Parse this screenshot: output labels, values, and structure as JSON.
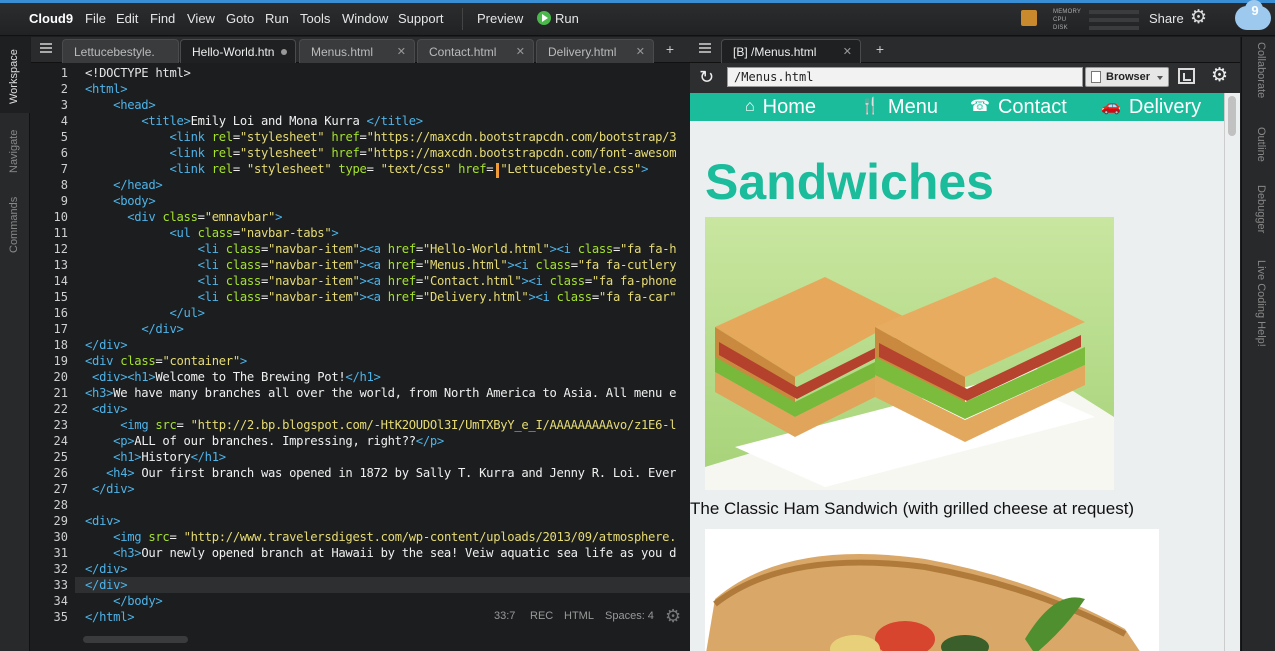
{
  "menubar": {
    "brand": "Cloud9",
    "items": [
      "File",
      "Edit",
      "Find",
      "View",
      "Goto",
      "Run",
      "Tools",
      "Window",
      "Support"
    ],
    "preview": "Preview",
    "run": "Run",
    "meters": [
      "MEMORY",
      "CPU",
      "DISK"
    ],
    "share": "Share"
  },
  "left_rail": [
    "Workspace",
    "Navigate",
    "Commands"
  ],
  "right_rail": [
    "Collaborate",
    "Outline",
    "Debugger",
    "Live Coding Help!"
  ],
  "editor_tabs": [
    {
      "label": "Lettucebestyle.",
      "active": false
    },
    {
      "label": "Hello-World.htn",
      "active": true
    },
    {
      "label": "Menus.html",
      "active": false
    },
    {
      "label": "Contact.html",
      "active": false
    },
    {
      "label": "Delivery.html",
      "active": false
    }
  ],
  "code_lines": [
    {
      "n": "1",
      "h": "<span class='p'>&lt;!DOCTYPE html&gt;</span>"
    },
    {
      "n": "2",
      "h": "<span class='t'>&lt;html&gt;</span>"
    },
    {
      "n": "3",
      "h": "    <span class='t'>&lt;head&gt;</span>"
    },
    {
      "n": "4",
      "h": "        <span class='t'>&lt;title&gt;</span>Emily Loi and Mona Kurra <span class='t'>&lt;/title&gt;</span>"
    },
    {
      "n": "5",
      "h": "            <span class='t'>&lt;link</span> <span class='a'>rel</span>=<span class='s'>\"stylesheet\"</span> <span class='a'>href</span>=<span class='s'>\"https://maxcdn.bootstrapcdn.com/bootstrap/3</span>"
    },
    {
      "n": "6",
      "h": "            <span class='t'>&lt;link</span> <span class='a'>rel</span>=<span class='s'>\"stylesheet\"</span> <span class='a'>href</span>=<span class='s'>\"https://maxcdn.bootstrapcdn.com/font-awesom</span>"
    },
    {
      "n": "7",
      "h": "            <span class='t'>&lt;link</span> <span class='a'>rel</span>= <span class='s'>\"stylesheet\"</span> <span class='a'>type</span>= <span class='s'>\"text/css\"</span> <span class='a'>href</span>= <span class='s'>\"Lettucebestyle.css\"</span><span class='t'>&gt;</span>"
    },
    {
      "n": "8",
      "h": "    <span class='t'>&lt;/head&gt;</span>"
    },
    {
      "n": "9",
      "h": "    <span class='t'>&lt;body&gt;</span>"
    },
    {
      "n": "10",
      "h": "      <span class='t'>&lt;div</span> <span class='a'>class</span>=<span class='s'>\"emnavbar\"</span><span class='t'>&gt;</span>"
    },
    {
      "n": "11",
      "h": "            <span class='t'>&lt;ul</span> <span class='a'>class</span>=<span class='s'>\"navbar-tabs\"</span><span class='t'>&gt;</span>"
    },
    {
      "n": "12",
      "h": "                <span class='t'>&lt;li</span> <span class='a'>class</span>=<span class='s'>\"navbar-item\"</span><span class='t'>&gt;&lt;a</span> <span class='a'>href</span>=<span class='s'>\"Hello-World.html\"</span><span class='t'>&gt;&lt;i</span> <span class='a'>class</span>=<span class='s'>\"fa fa-h</span>"
    },
    {
      "n": "13",
      "h": "                <span class='t'>&lt;li</span> <span class='a'>class</span>=<span class='s'>\"navbar-item\"</span><span class='t'>&gt;&lt;a</span> <span class='a'>href</span>=<span class='s'>\"Menus.html\"</span><span class='t'>&gt;&lt;i</span> <span class='a'>class</span>=<span class='s'>\"fa fa-cutlery</span>"
    },
    {
      "n": "14",
      "h": "                <span class='t'>&lt;li</span> <span class='a'>class</span>=<span class='s'>\"navbar-item\"</span><span class='t'>&gt;&lt;a</span> <span class='a'>href</span>=<span class='s'>\"Contact.html\"</span><span class='t'>&gt;&lt;i</span> <span class='a'>class</span>=<span class='s'>\"fa fa-phone</span>"
    },
    {
      "n": "15",
      "h": "                <span class='t'>&lt;li</span> <span class='a'>class</span>=<span class='s'>\"navbar-item\"</span><span class='t'>&gt;&lt;a</span> <span class='a'>href</span>=<span class='s'>\"Delivery.html\"</span><span class='t'>&gt;&lt;i</span> <span class='a'>class</span>=<span class='s'>\"fa fa-car\"</span>"
    },
    {
      "n": "16",
      "h": "            <span class='t'>&lt;/ul&gt;</span>"
    },
    {
      "n": "17",
      "h": "        <span class='t'>&lt;/div&gt;</span>"
    },
    {
      "n": "18",
      "h": "<span class='t'>&lt;/div&gt;</span>"
    },
    {
      "n": "19",
      "h": "<span class='t'>&lt;div</span> <span class='a'>class</span>=<span class='s'>\"container\"</span><span class='t'>&gt;</span>"
    },
    {
      "n": "20",
      "h": " <span class='t'>&lt;div&gt;&lt;h1&gt;</span>Welcome to The Brewing Pot!<span class='t'>&lt;/h1&gt;</span>"
    },
    {
      "n": "21",
      "h": "<span class='t'>&lt;h3&gt;</span>We have many branches all over the world, from North America to Asia. All menu e"
    },
    {
      "n": "22",
      "h": " <span class='t'>&lt;div&gt;</span>"
    },
    {
      "n": "23",
      "h": "     <span class='t'>&lt;img</span> <span class='a'>src</span>= <span class='s'>\"http://2.bp.blogspot.com/-HtK2OUDOl3I/UmTXByY_e_I/AAAAAAAAAvo/z1E6-l</span>"
    },
    {
      "n": "24",
      "h": "    <span class='t'>&lt;p&gt;</span>ALL of our branches. Impressing, right??<span class='t'>&lt;/p&gt;</span>"
    },
    {
      "n": "25",
      "h": "    <span class='t'>&lt;h1&gt;</span>History<span class='t'>&lt;/h1&gt;</span>"
    },
    {
      "n": "26",
      "h": "   <span class='t'>&lt;h4&gt;</span> Our first branch was opened in 1872 by Sally T. Kurra and Jenny R. Loi. Ever"
    },
    {
      "n": "27",
      "h": " <span class='t'>&lt;/div&gt;</span>"
    },
    {
      "n": "28",
      "h": ""
    },
    {
      "n": "29",
      "h": "<span class='t'>&lt;div&gt;</span>"
    },
    {
      "n": "30",
      "h": "    <span class='t'>&lt;img</span> <span class='a'>src</span>= <span class='s'>\"http://www.travelersdigest.com/wp-content/uploads/2013/09/atmosphere.</span>"
    },
    {
      "n": "31",
      "h": "    <span class='t'>&lt;h3&gt;</span>Our newly opened branch at Hawaii by the sea! Veiw aquatic sea life as you d"
    },
    {
      "n": "32",
      "h": "<span class='t'>&lt;/div&gt;</span>"
    },
    {
      "n": "33",
      "h": "<span class='t'>&lt;/div&gt;</span>"
    },
    {
      "n": "34",
      "h": "    <span class='t'>&lt;/body&gt;</span>"
    },
    {
      "n": "35",
      "h": "<span class='t'>&lt;/html&gt;</span>"
    }
  ],
  "status": {
    "position": "33:7",
    "rec": "REC",
    "mode": "HTML",
    "spaces": "Spaces: 4"
  },
  "preview": {
    "tab_label": "[B] /Menus.html",
    "url": "/Menus.html",
    "browser_select": "Browser",
    "nav": [
      {
        "icon": "home-icon",
        "label": "Home"
      },
      {
        "icon": "cutlery-icon",
        "label": "Menu"
      },
      {
        "icon": "phone-icon",
        "label": "Contact"
      },
      {
        "icon": "car-icon",
        "label": "Delivery"
      }
    ],
    "heading": "Sandwiches",
    "caption1": "The Classic Ham Sandwich (with grilled cheese at request)"
  },
  "colors": {
    "accent": "#1abc9c",
    "tag": "#4fb3e8",
    "attr": "#a6e22e",
    "string": "#e6db74"
  }
}
